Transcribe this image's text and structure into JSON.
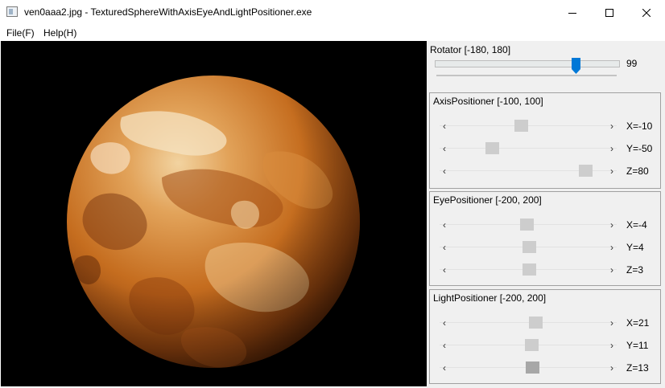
{
  "window": {
    "title": "ven0aaa2.jpg - TexturedSphereWithAxisEyeAndLightPositioner.exe"
  },
  "menu": [
    {
      "label": "File(F)"
    },
    {
      "label": "Help(H)"
    }
  ],
  "rotator": {
    "title": "Rotator [-180, 180]",
    "value": "99",
    "min": -180,
    "max": 180,
    "current": 99,
    "accent": "#0078d7"
  },
  "axis": {
    "title": "AxisPositioner [-100, 100]",
    "min": -100,
    "max": 100,
    "rows": [
      {
        "label": "X=-10",
        "value": -10
      },
      {
        "label": "Y=-50",
        "value": -50
      },
      {
        "label": "Z=80",
        "value": 80
      }
    ]
  },
  "eye": {
    "title": "EyePositioner [-200, 200]",
    "min": -200,
    "max": 200,
    "rows": [
      {
        "label": "X=-4",
        "value": -4
      },
      {
        "label": "Y=4",
        "value": 4
      },
      {
        "label": "Z=3",
        "value": 3
      }
    ]
  },
  "light": {
    "title": "LightPositioner [-200, 200]",
    "min": -200,
    "max": 200,
    "rows": [
      {
        "label": "X=21",
        "value": 21
      },
      {
        "label": "Y=11",
        "value": 11
      },
      {
        "label": "Z=13",
        "value": 13
      }
    ]
  },
  "scroll_arrows": {
    "left": "‹",
    "right": "›"
  },
  "colors": {
    "planet_light": "#f3d9ae",
    "planet_mid": "#c9721e",
    "planet_dark": "#5a2a08",
    "thumb": "#cdcdcd",
    "thumb_active": "#a7a7a7"
  }
}
